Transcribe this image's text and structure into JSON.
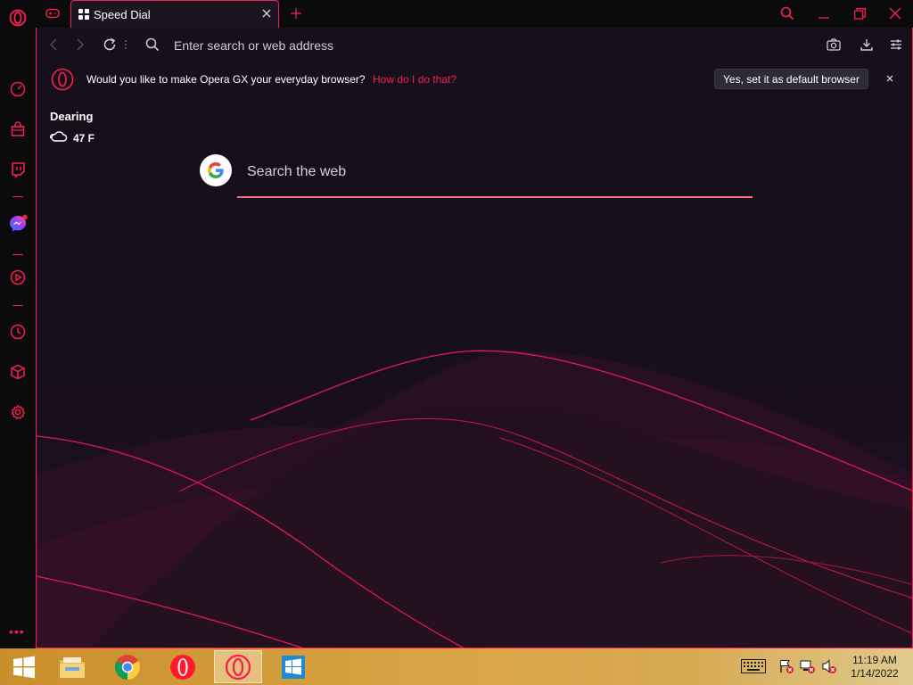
{
  "window": {
    "tab_title": "Speed Dial"
  },
  "addressbar": {
    "placeholder": "Enter search or web address"
  },
  "banner": {
    "text": "Would you like to make Opera GX your everyday browser?",
    "link": "How do I do that?",
    "button": "Yes, set it as default browser"
  },
  "weather": {
    "location": "Dearing",
    "temperature": "47 F"
  },
  "search": {
    "placeholder": "Search the web"
  },
  "clock": {
    "time": "11:19 AM",
    "date": "1/14/2022"
  },
  "colors": {
    "accent": "#fa1e4e",
    "background": "#16101c",
    "sidebar": "#0b0b0e"
  },
  "icons": {
    "sidebar": [
      "opera-gx-logo-icon",
      "speedometer-icon",
      "shopping-bag-icon",
      "twitch-icon",
      "messenger-icon",
      "player-icon",
      "history-icon",
      "cube-icon",
      "settings-icon"
    ],
    "tray": [
      "keyboard-icon",
      "action-center-flag-icon",
      "network-icon",
      "volume-muted-icon"
    ]
  }
}
